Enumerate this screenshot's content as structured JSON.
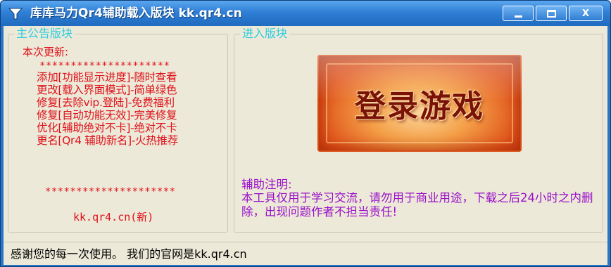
{
  "window": {
    "title": "库库马力Qr4辅助载入版块 kk.qr4.cn",
    "controls": {
      "minimize": "minimize",
      "maximize": "maximize",
      "close": "X"
    }
  },
  "main_panel": {
    "legend": "主公告版块",
    "heading": "本次更新:",
    "stars_top": "*********************",
    "updates": [
      "添加[功能显示进度]-随时查看",
      "更改[载入界面模式]-简单绿色",
      "修复[去除vip.登陆]-免费福利",
      "修复[自动功能无效]-完美修复",
      "优化[辅助绝对不卡]-绝对不卡",
      "更名[Qr4 辅助新名]-火热推荐"
    ],
    "stars_bottom": "*********************",
    "site_note": "kk.qr4.cn(新)"
  },
  "enter_panel": {
    "legend": "进入版块",
    "login_button": "登录游戏",
    "disclaimer_title": "辅助注明:",
    "disclaimer_body": "本工具仅用于学习交流，请勿用于商业用途，下载之后24小时之内删除，出现问题作者不担当责任!"
  },
  "statusbar": {
    "text": "感谢您的每一次使用。 我们的官网是kk.qr4.cn"
  },
  "colors": {
    "titlebar": "#2f7fd6",
    "client_bg": "#ece9d8",
    "legend": "#2fcce0",
    "notice_red": "#e0101a",
    "disclaimer_purple": "#9a10c8"
  },
  "icons": {
    "app": "funnel-app-icon"
  }
}
